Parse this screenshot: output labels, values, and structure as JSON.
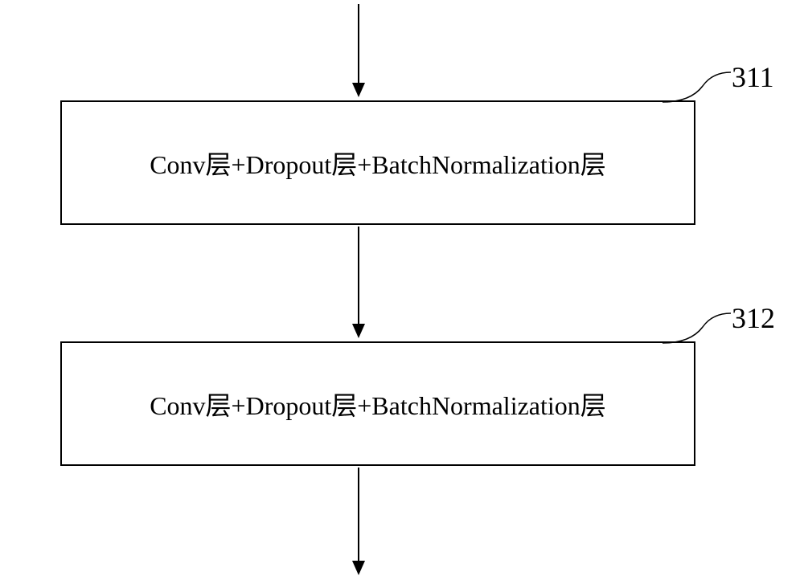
{
  "blocks": [
    {
      "id": "311",
      "label": "Conv层+Dropout层+BatchNormalization层",
      "ref": "311"
    },
    {
      "id": "312",
      "label": "Conv层+Dropout层+BatchNormalization层",
      "ref": "312"
    }
  ]
}
